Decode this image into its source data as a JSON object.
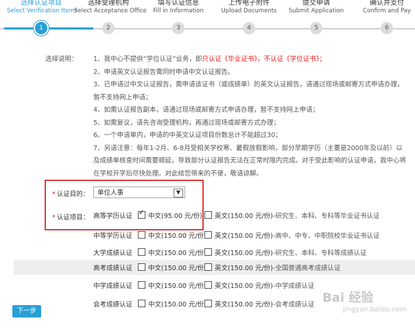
{
  "steps": [
    {
      "cn": "选择认证项目",
      "en": "Select Verification Items",
      "num": "1"
    },
    {
      "cn": "选择受理机构",
      "en": "Select Acceptance Office",
      "num": "2"
    },
    {
      "cn": "填写认证信息",
      "en": "Fill in Information",
      "num": "3"
    },
    {
      "cn": "上传电子附件",
      "en": "Upload Documents",
      "num": "4"
    },
    {
      "cn": "提交申请",
      "en": "Submit Application",
      "num": "5"
    },
    {
      "cn": "确认并支付",
      "en": "Confirm and Pay",
      "num": "6"
    }
  ],
  "notes": {
    "label": "选择说明：",
    "items": [
      {
        "pre": "1、我中心不提供“学位认证”业务，即",
        "red": "只认证《毕业证书》，不认证《学位证书》；"
      },
      {
        "pre": "2、申请英文认证报告需同时申请中文认证报告。"
      },
      {
        "pre": "3、已申请过中文认证报告，需申请该证书（或成绩单）的英文认证报告，请通过现场或邮寄方式申请办理，暂不支持网上申请；"
      },
      {
        "pre": "4、如需认证报告副本，请通过现场或邮寄方式申请办理，暂不支持网上申请；"
      },
      {
        "pre": "5、如需复议，请先咨询受理机构，再通过现场或邮寄方式办理；"
      },
      {
        "pre": "6、一个申请单内，申请的中英文认证项目份数总计不能超过30；"
      },
      {
        "pre": "7、另请注意：每年1-2月、6-8月受相关学校寒、暑假放假影响，部分早期学历（主要是2000年及以前）以及成绩单核查时间需要顺延，导致部分认证报告无法在正常时限内完成。对于受此影响的认证申请，我中心将在学校开学后尽快处理。对此给您带来的不便，敬请谅解。"
      }
    ]
  },
  "form": {
    "purpose_label": "认证目的：",
    "purpose_value": "单位人事",
    "items_label": "认证项目："
  },
  "rows": [
    {
      "name": "高等学历认证",
      "cn_opt": "中文(95.00 元/份)",
      "cn_checked": true,
      "en_opt": "英文(150.00 元/份)",
      "desc": "-研究生、本科、专科等毕业证书认证"
    },
    {
      "name": "中等学历认证",
      "cn_opt": "中文(150.00 元/份)",
      "cn_checked": false,
      "en_opt": "英文(150.00 元/份)",
      "desc": "-高中、中专、中职院校毕业证书认证"
    },
    {
      "name": "大学成绩认证",
      "cn_opt": "中文(150.00 元/份)",
      "cn_checked": false,
      "en_opt": "英文(150.00 元/份)",
      "desc": "-研究生、本科、专科等成绩认证"
    },
    {
      "name": "高考成绩认证",
      "cn_opt": "中文(150.00 元/份)",
      "cn_checked": false,
      "en_opt": "英文(150.00 元/份)",
      "desc": "-全国普通高考成绩认证"
    },
    {
      "name": "中学成绩认证",
      "cn_opt": "中文(150.00 元/份)",
      "cn_checked": false,
      "en_opt": "英文(150.00 元/份)",
      "desc": "-中学成绩认证"
    },
    {
      "name": "会考成绩认证",
      "cn_opt": "中文(150.00 元/份)",
      "cn_checked": false,
      "en_opt": "英文(150.00 元/份)",
      "desc": "-会考成绩认证"
    }
  ],
  "next_button": "下一步",
  "watermark": {
    "main": "Bai 经验",
    "sub": "jingyan.baidu.com"
  },
  "colors": {
    "accent": "#2a9fd6",
    "highlight_border": "#e03a3a",
    "warning_text": "#e02020"
  }
}
